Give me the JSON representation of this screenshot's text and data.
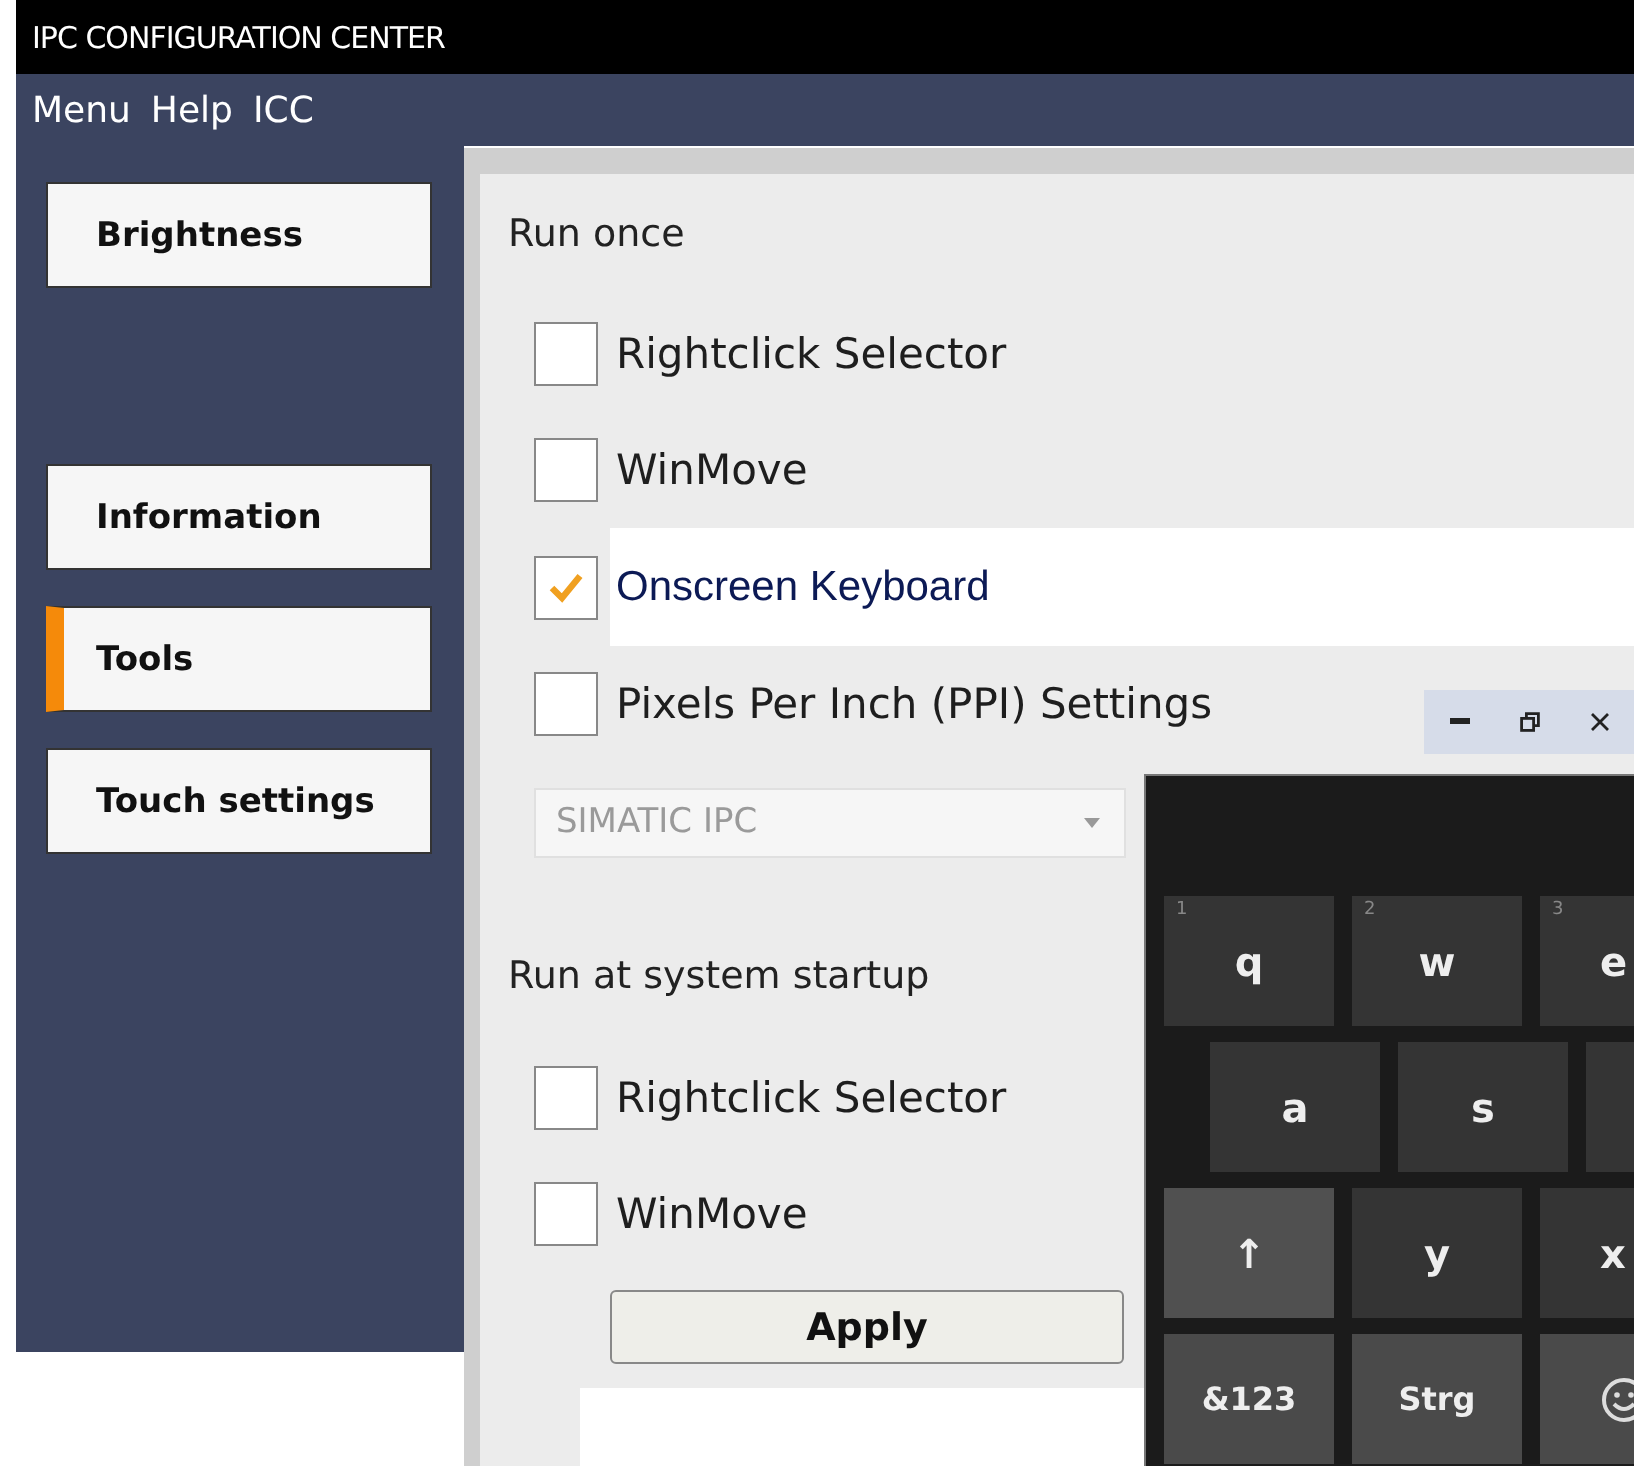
{
  "window": {
    "title": "IPC CONFIGURATION CENTER"
  },
  "menu": [
    "Menu",
    "Help",
    "ICC"
  ],
  "sidebar": {
    "items": [
      {
        "label": "Brightness",
        "selected": false
      },
      {
        "label": "Information",
        "selected": false
      },
      {
        "label": "Tools",
        "selected": true
      },
      {
        "label": "Touch settings",
        "selected": false
      }
    ]
  },
  "run_once": {
    "heading": "Run once",
    "options": [
      {
        "label": "Rightclick Selector",
        "checked": false,
        "selected": false
      },
      {
        "label": "WinMove",
        "checked": false,
        "selected": false
      },
      {
        "label": "Onscreen Keyboard",
        "checked": true,
        "selected": true
      },
      {
        "label": "Pixels Per Inch (PPI) Settings",
        "checked": false,
        "selected": false
      }
    ]
  },
  "dropdown": {
    "value": "SIMATIC IPC",
    "disabled": true
  },
  "run_at_startup": {
    "heading": "Run at system startup",
    "options": [
      {
        "label": "Rightclick Selector",
        "checked": false
      },
      {
        "label": "WinMove",
        "checked": false
      }
    ]
  },
  "apply_button": "Apply",
  "keyboard": {
    "rows": [
      [
        {
          "kind": "char",
          "label": "q",
          "hint": "1"
        },
        {
          "kind": "char",
          "label": "w",
          "hint": "2"
        },
        {
          "kind": "char",
          "label": "e",
          "hint": "3"
        }
      ],
      [
        {
          "kind": "char",
          "label": "a"
        },
        {
          "kind": "char",
          "label": "s"
        },
        {
          "kind": "blank"
        }
      ],
      [
        {
          "kind": "shift",
          "label": "↑"
        },
        {
          "kind": "char",
          "label": "y"
        },
        {
          "kind": "char",
          "label": "x"
        }
      ],
      [
        {
          "kind": "mod",
          "label": "&123"
        },
        {
          "kind": "mod",
          "label": "Strg"
        },
        {
          "kind": "emoji"
        }
      ]
    ]
  }
}
